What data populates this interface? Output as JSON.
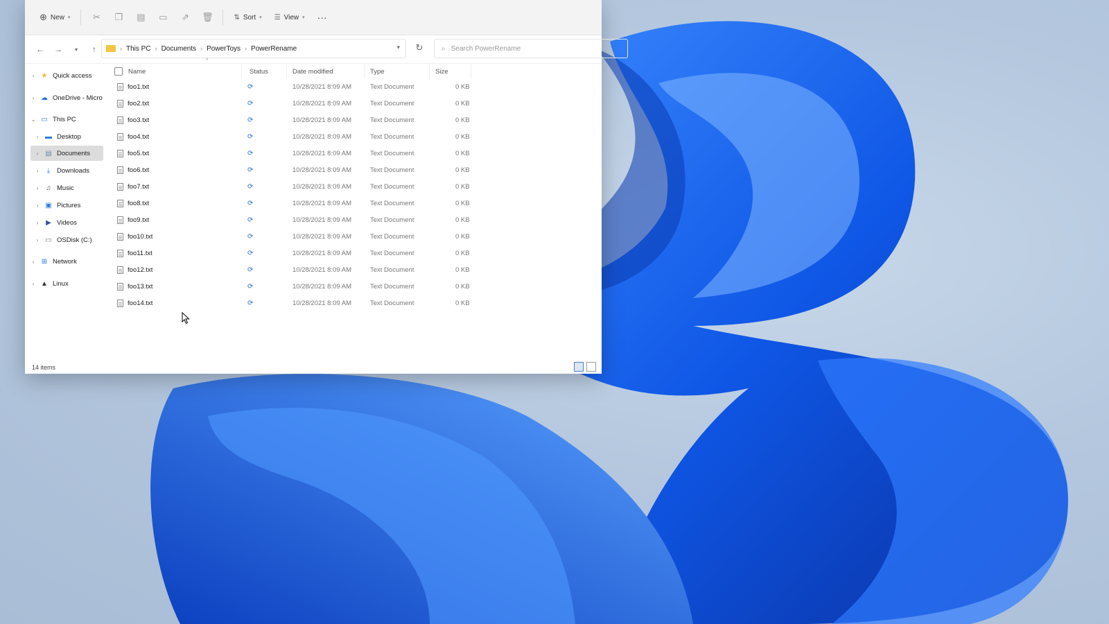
{
  "toolbar": {
    "new_label": "New",
    "sort_label": "Sort",
    "view_label": "View",
    "more_label": "···"
  },
  "breadcrumb": [
    "This PC",
    "Documents",
    "PowerToys",
    "PowerRename"
  ],
  "search": {
    "placeholder": "Search PowerRename"
  },
  "sidebar": {
    "items": [
      {
        "label": "Quick access",
        "icon": "star-icon"
      },
      {
        "label": "OneDrive - Micro",
        "icon": "cloud-icon"
      },
      {
        "label": "This PC",
        "icon": "computer-icon"
      },
      {
        "label": "Desktop",
        "icon": "desktop-icon"
      },
      {
        "label": "Documents",
        "icon": "documents-icon"
      },
      {
        "label": "Downloads",
        "icon": "download-icon"
      },
      {
        "label": "Music",
        "icon": "music-icon"
      },
      {
        "label": "Pictures",
        "icon": "pictures-icon"
      },
      {
        "label": "Videos",
        "icon": "videos-icon"
      },
      {
        "label": "OSDisk (C:)",
        "icon": "disk-icon"
      },
      {
        "label": "Network",
        "icon": "network-icon"
      },
      {
        "label": "Linux",
        "icon": "linux-icon"
      }
    ]
  },
  "columns": {
    "name": "Name",
    "status": "Status",
    "date": "Date modified",
    "type": "Type",
    "size": "Size"
  },
  "files": [
    {
      "name": "foo1.txt",
      "date": "10/28/2021 8:09 AM",
      "type": "Text Document",
      "size": "0 KB"
    },
    {
      "name": "foo2.txt",
      "date": "10/28/2021 8:09 AM",
      "type": "Text Document",
      "size": "0 KB"
    },
    {
      "name": "foo3.txt",
      "date": "10/28/2021 8:09 AM",
      "type": "Text Document",
      "size": "0 KB"
    },
    {
      "name": "foo4.txt",
      "date": "10/28/2021 8:09 AM",
      "type": "Text Document",
      "size": "0 KB"
    },
    {
      "name": "foo5.txt",
      "date": "10/28/2021 8:09 AM",
      "type": "Text Document",
      "size": "0 KB"
    },
    {
      "name": "foo6.txt",
      "date": "10/28/2021 8:09 AM",
      "type": "Text Document",
      "size": "0 KB"
    },
    {
      "name": "foo7.txt",
      "date": "10/28/2021 8:09 AM",
      "type": "Text Document",
      "size": "0 KB"
    },
    {
      "name": "foo8.txt",
      "date": "10/28/2021 8:09 AM",
      "type": "Text Document",
      "size": "0 KB"
    },
    {
      "name": "foo9.txt",
      "date": "10/28/2021 8:09 AM",
      "type": "Text Document",
      "size": "0 KB"
    },
    {
      "name": "foo10.txt",
      "date": "10/28/2021 8:09 AM",
      "type": "Text Document",
      "size": "0 KB"
    },
    {
      "name": "foo11.txt",
      "date": "10/28/2021 8:09 AM",
      "type": "Text Document",
      "size": "0 KB"
    },
    {
      "name": "foo12.txt",
      "date": "10/28/2021 8:09 AM",
      "type": "Text Document",
      "size": "0 KB"
    },
    {
      "name": "foo13.txt",
      "date": "10/28/2021 8:09 AM",
      "type": "Text Document",
      "size": "0 KB"
    },
    {
      "name": "foo14.txt",
      "date": "10/28/2021 8:09 AM",
      "type": "Text Document",
      "size": "0 KB"
    }
  ],
  "status_bar": {
    "item_count": "14 items"
  },
  "colors": {
    "accent": "#2f6fd1",
    "folder": "#f4c541",
    "wallpaper_bloom": "#1a5fe0"
  }
}
